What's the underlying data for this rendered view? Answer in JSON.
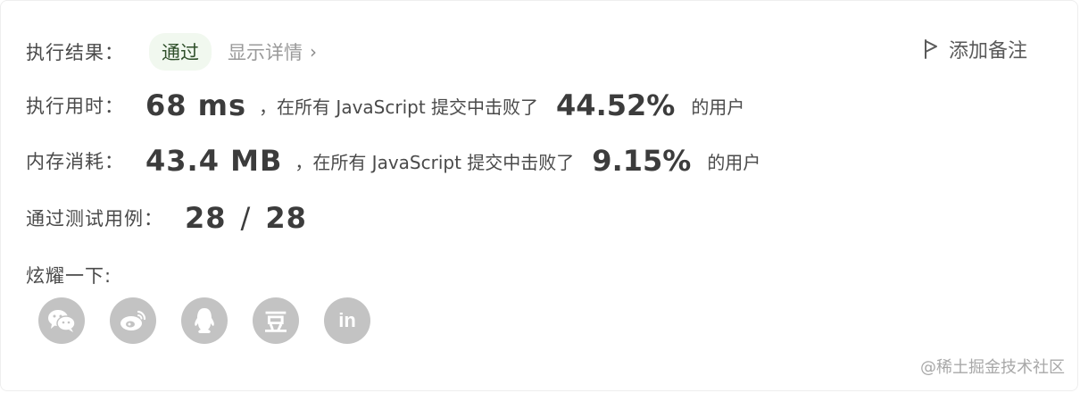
{
  "result": {
    "label": "执行结果：",
    "status": "通过",
    "details_link": "显示详情",
    "add_note": "添加备注"
  },
  "runtime": {
    "label": "执行用时：",
    "value": "68 ms",
    "text_before": "，在所有 JavaScript 提交中击败了",
    "percent": "44.52%",
    "text_after": "的用户"
  },
  "memory": {
    "label": "内存消耗：",
    "value": "43.4 MB",
    "text_before": "，在所有 JavaScript 提交中击败了",
    "percent": "9.15%",
    "text_after": "的用户"
  },
  "tests": {
    "label": "通过测试用例：",
    "passed": "28",
    "separator": "/",
    "total": "28"
  },
  "share": {
    "label": "炫耀一下:",
    "icons": [
      "wechat-icon",
      "weibo-icon",
      "qq-icon",
      "douban-icon",
      "linkedin-icon"
    ],
    "douban_glyph": "豆",
    "linkedin_glyph": "in"
  },
  "watermark": "@稀土掘金技术社区",
  "colors": {
    "badge_bg": "#f1f8ef",
    "badge_text": "#2f4f2a",
    "share_icon_bg": "#c3c3c3"
  }
}
